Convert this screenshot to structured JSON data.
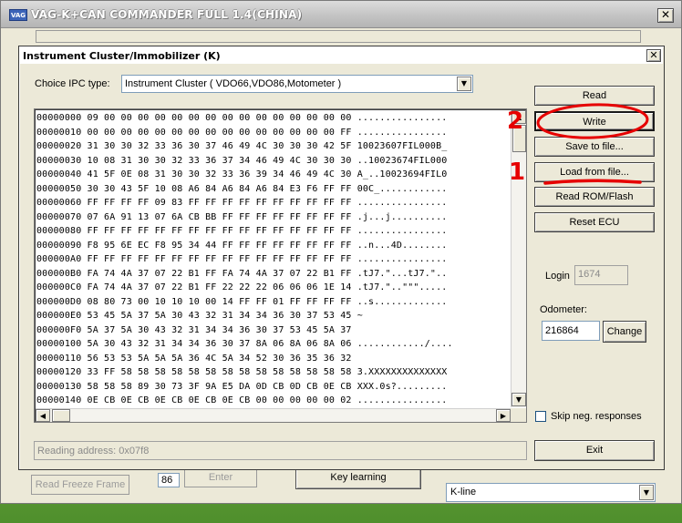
{
  "app": {
    "title": "VAG-K+CAN COMMANDER FULL 1.4(CHINA)",
    "icon_label": "VAG",
    "close_glyph": "✕"
  },
  "background_controls": {
    "read_freeze_frame": "Read Freeze Frame",
    "freeze_value": "86",
    "enter": "Enter",
    "key_learning": "Key learning",
    "protocol": "K-line"
  },
  "dialog": {
    "title": "Instrument Cluster/Immobilizer (K)",
    "close_glyph": "✕",
    "ipc_label": "Choice IPC type:",
    "ipc_value": "Instrument Cluster ( VDO66,VDO86,Motometer )",
    "hex_lines": [
      "00000000 09 00 00 00 00 00 00 00 00 00 00 00 00 00 00 00 ................",
      "00000010 00 00 00 00 00 00 00 00 00 00 00 00 00 00 00 FF ................",
      "00000020 31 30 30 32 33 36 30 37 46 49 4C 30 30 30 42 5F 10023607FIL000B_",
      "00000030 10 08 31 30 30 32 33 36 37 34 46 49 4C 30 30 30 ..10023674FIL000",
      "00000040 41 5F 0E 08 31 30 30 32 33 36 39 34 46 49 4C 30 A_..10023694FIL0",
      "00000050 30 30 43 5F 10 08 A6 84 A6 84 A6 84 E3 F6 FF FF 00C_............",
      "00000060 FF FF FF FF 09 83 FF FF FF FF FF FF FF FF FF FF ................",
      "00000070 07 6A 91 13 07 6A CB BB FF FF FF FF FF FF FF FF .j...j..........",
      "00000080 FF FF FF FF FF FF FF FF FF FF FF FF FF FF FF FF ................",
      "00000090 F8 95 6E EC F8 95 34 44 FF FF FF FF FF FF FF FF ..n...4D........",
      "000000A0 FF FF FF FF FF FF FF FF FF FF FF FF FF FF FF FF ................",
      "000000B0 FA 74 4A 37 07 22 B1 FF FA 74 4A 37 07 22 B1 FF .tJ7.\"...tJ7.\"..",
      "000000C0 FA 74 4A 37 07 22 B1 FF 22 22 22 06 06 06 1E 14 .tJ7.\"..\"\"\".....",
      "000000D0 08 80 73 00 10 10 10 00 14 FF FF 01 FF FF FF FF ..s.............",
      "000000E0 53 45 5A 37 5A 30 43 32 31 34 34 36 30 37 53 45 ~",
      "000000F0 5A 37 5A 30 43 32 31 34 34 36 30 37 53 45 5A 37",
      "00000100 5A 30 43 32 31 34 34 36 30 37 8A 06 8A 06 8A 06 ............/....",
      "00000110 56 53 53 5A 5A 5A 36 4C 5A 34 52 30 36 35 36 32",
      "00000120 33 FF 58 58 58 58 58 58 58 58 58 58 58 58 58 58 3.XXXXXXXXXXXXXX",
      "00000130 58 58 58 89 30 73 3F 9A E5 DA 0D CB 0D CB 0E CB XXX.0s?.........",
      "00000140 0E CB 0E CB 0E CB 0E CB 0E CB 00 00 00 00 00 02 ................"
    ],
    "buttons": {
      "read": "Read",
      "write": "Write",
      "save": "Save to file...",
      "load": "Load from file...",
      "read_rom": "Read ROM/Flash",
      "reset_ecu": "Reset ECU",
      "change": "Change",
      "exit": "Exit"
    },
    "login_label": "Login",
    "login_value": "1674",
    "odometer_label": "Odometer:",
    "odometer_value": "216864",
    "skip_label": "Skip neg. responses",
    "skip_checked": false,
    "status": "Reading address: 0x07f8"
  },
  "annotations": {
    "step1": "1",
    "step2": "2",
    "color": "#e60000"
  }
}
